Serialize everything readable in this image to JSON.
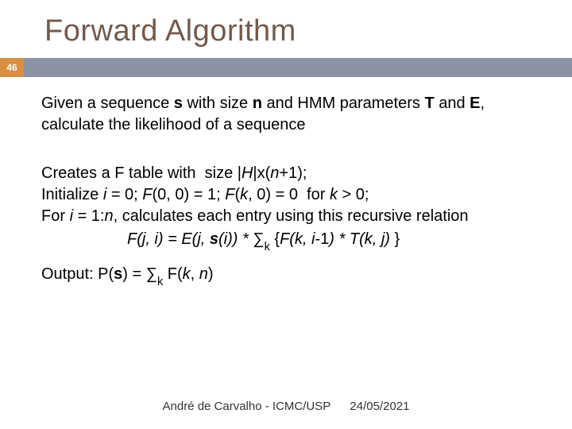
{
  "title": "Forward Algorithm",
  "page_number": "46",
  "intro_html": "Given a sequence <span class='bold'>s</span> with size <span class='bold'>n</span> and HMM parameters <span class='bold'>T</span> and <span class='bold'>E</span>, calculate the likelihood of a sequence",
  "line1_html": "Creates a F table with&nbsp; size |<span class='italic'>H</span>|x(<span class='italic'>n</span>+1);",
  "line2_html": "Initialize <span class='italic'>i</span> = 0; <span class='italic'>F</span>(0, 0) = 1; <span class='italic'>F</span>(<span class='italic'>k</span>, 0) = 0&nbsp; for <span class='italic'>k</span> &gt; 0;",
  "line3_html": "For <span class='italic'>i</span> = 1:<span class='italic'>n</span>, calculates each entry using this recursive relation",
  "formula_html": "F(j, i) = E(j, <span class='bold'>s</span>(i)) * <span style='font-style:normal'>∑</span><span class='sub' style='font-style:normal'>k</span> <span style='font-style:normal'>{</span>F(k, i<span style='font-style:normal'>-1</span>) * T(k, j) <span style='font-style:normal'>}</span>",
  "output_html": "Output: P(<span class='bold'>s</span>) = ∑<span class='sub'>k</span> F(<span class='italic'>k</span>, <span class='italic'>n</span>)",
  "footer_author": "André de Carvalho - ICMC/USP",
  "footer_date": "24/05/2021"
}
